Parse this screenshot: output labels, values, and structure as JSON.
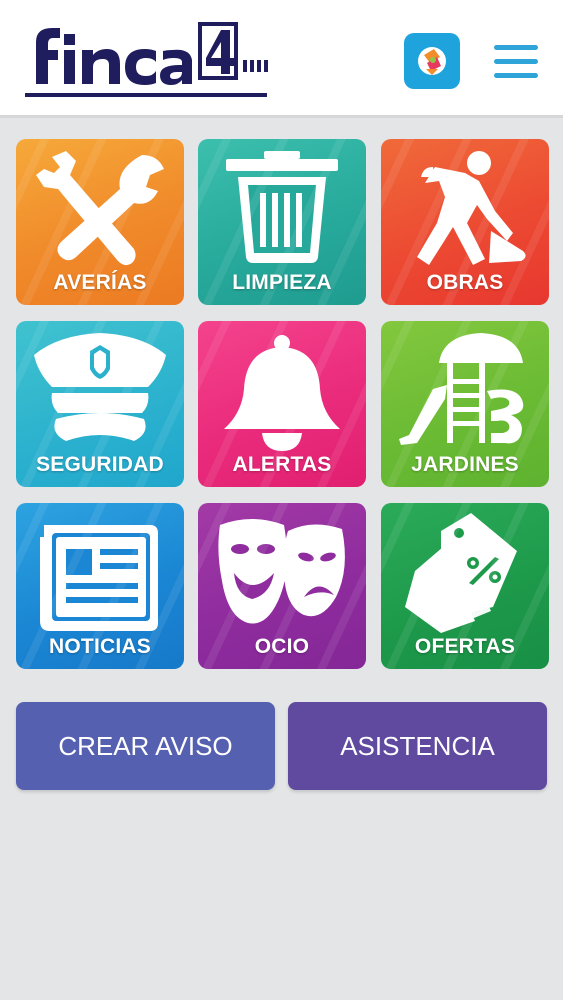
{
  "header": {
    "logo_text": "finca4",
    "app_icon": "discount-tag-app-icon",
    "menu_icon": "hamburger-menu-icon"
  },
  "tiles": [
    {
      "label": "AVERÍAS",
      "icon": "tools-icon",
      "color": "#f08a2a"
    },
    {
      "label": "LIMPIEZA",
      "icon": "trash-bin-icon",
      "color": "#26a89a"
    },
    {
      "label": "OBRAS",
      "icon": "construction-worker-icon",
      "color": "#ec4a32"
    },
    {
      "label": "SEGURIDAD",
      "icon": "police-cap-icon",
      "color": "#2bb1ce"
    },
    {
      "label": "ALERTAS",
      "icon": "bell-icon",
      "color": "#ea2b7b"
    },
    {
      "label": "JARDINES",
      "icon": "playground-icon",
      "color": "#6bbb34"
    },
    {
      "label": "NOTICIAS",
      "icon": "newspaper-icon",
      "color": "#1b87d4"
    },
    {
      "label": "OCIO",
      "icon": "theater-masks-icon",
      "color": "#8f2c9e"
    },
    {
      "label": "OFERTAS",
      "icon": "price-tags-icon",
      "color": "#1e9a4b"
    }
  ],
  "actions": {
    "create_label": "CREAR AVISO",
    "assist_label": "ASISTENCIA"
  },
  "colors": {
    "brand_navy": "#1f1d5e",
    "menu_blue": "#2fa4d8",
    "background": "#e4e5e7"
  }
}
